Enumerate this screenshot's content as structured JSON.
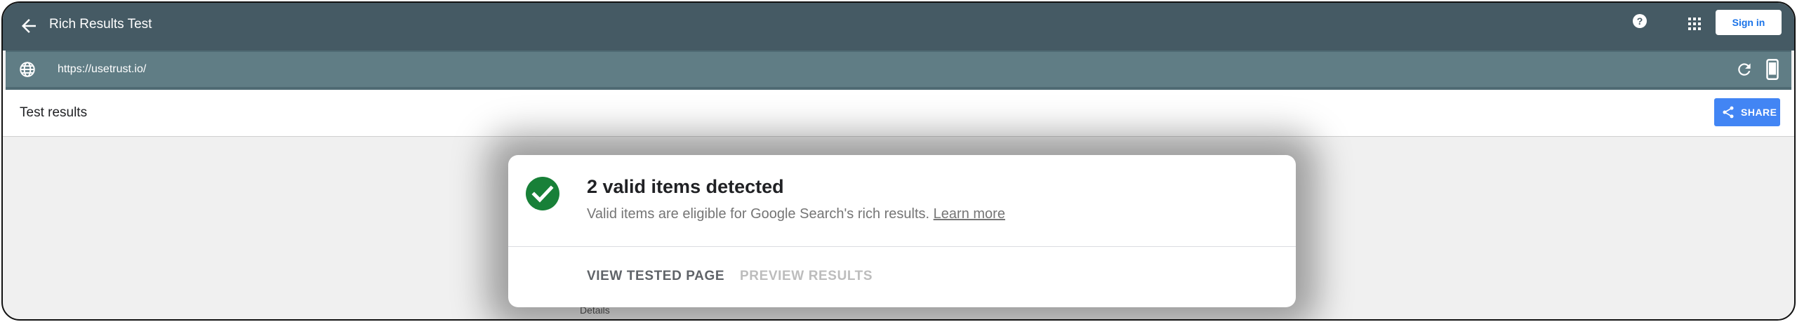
{
  "header": {
    "title": "Rich Results Test",
    "signin_label": "Sign in",
    "icons": {
      "back": "arrow-back-icon",
      "help": "help-icon",
      "apps": "apps-grid-icon"
    }
  },
  "urlbar": {
    "url": "https://usetrust.io/",
    "icons": {
      "globe": "globe-icon",
      "reload": "reload-icon",
      "device": "smartphone-icon"
    }
  },
  "results": {
    "title": "Test results",
    "share_label": "SHARE",
    "details_label": "Details"
  },
  "card": {
    "headline": "2 valid items detected",
    "subline": "Valid items are eligible for Google Search's rich results.",
    "learn_more": "Learn more",
    "view_tested_page": "VIEW TESTED PAGE",
    "preview_results": "PREVIEW RESULTS"
  },
  "colors": {
    "header_bg": "#455a64",
    "urlbar_bg": "#607d85",
    "share_bg": "#4285f4",
    "check_green": "#188038"
  }
}
